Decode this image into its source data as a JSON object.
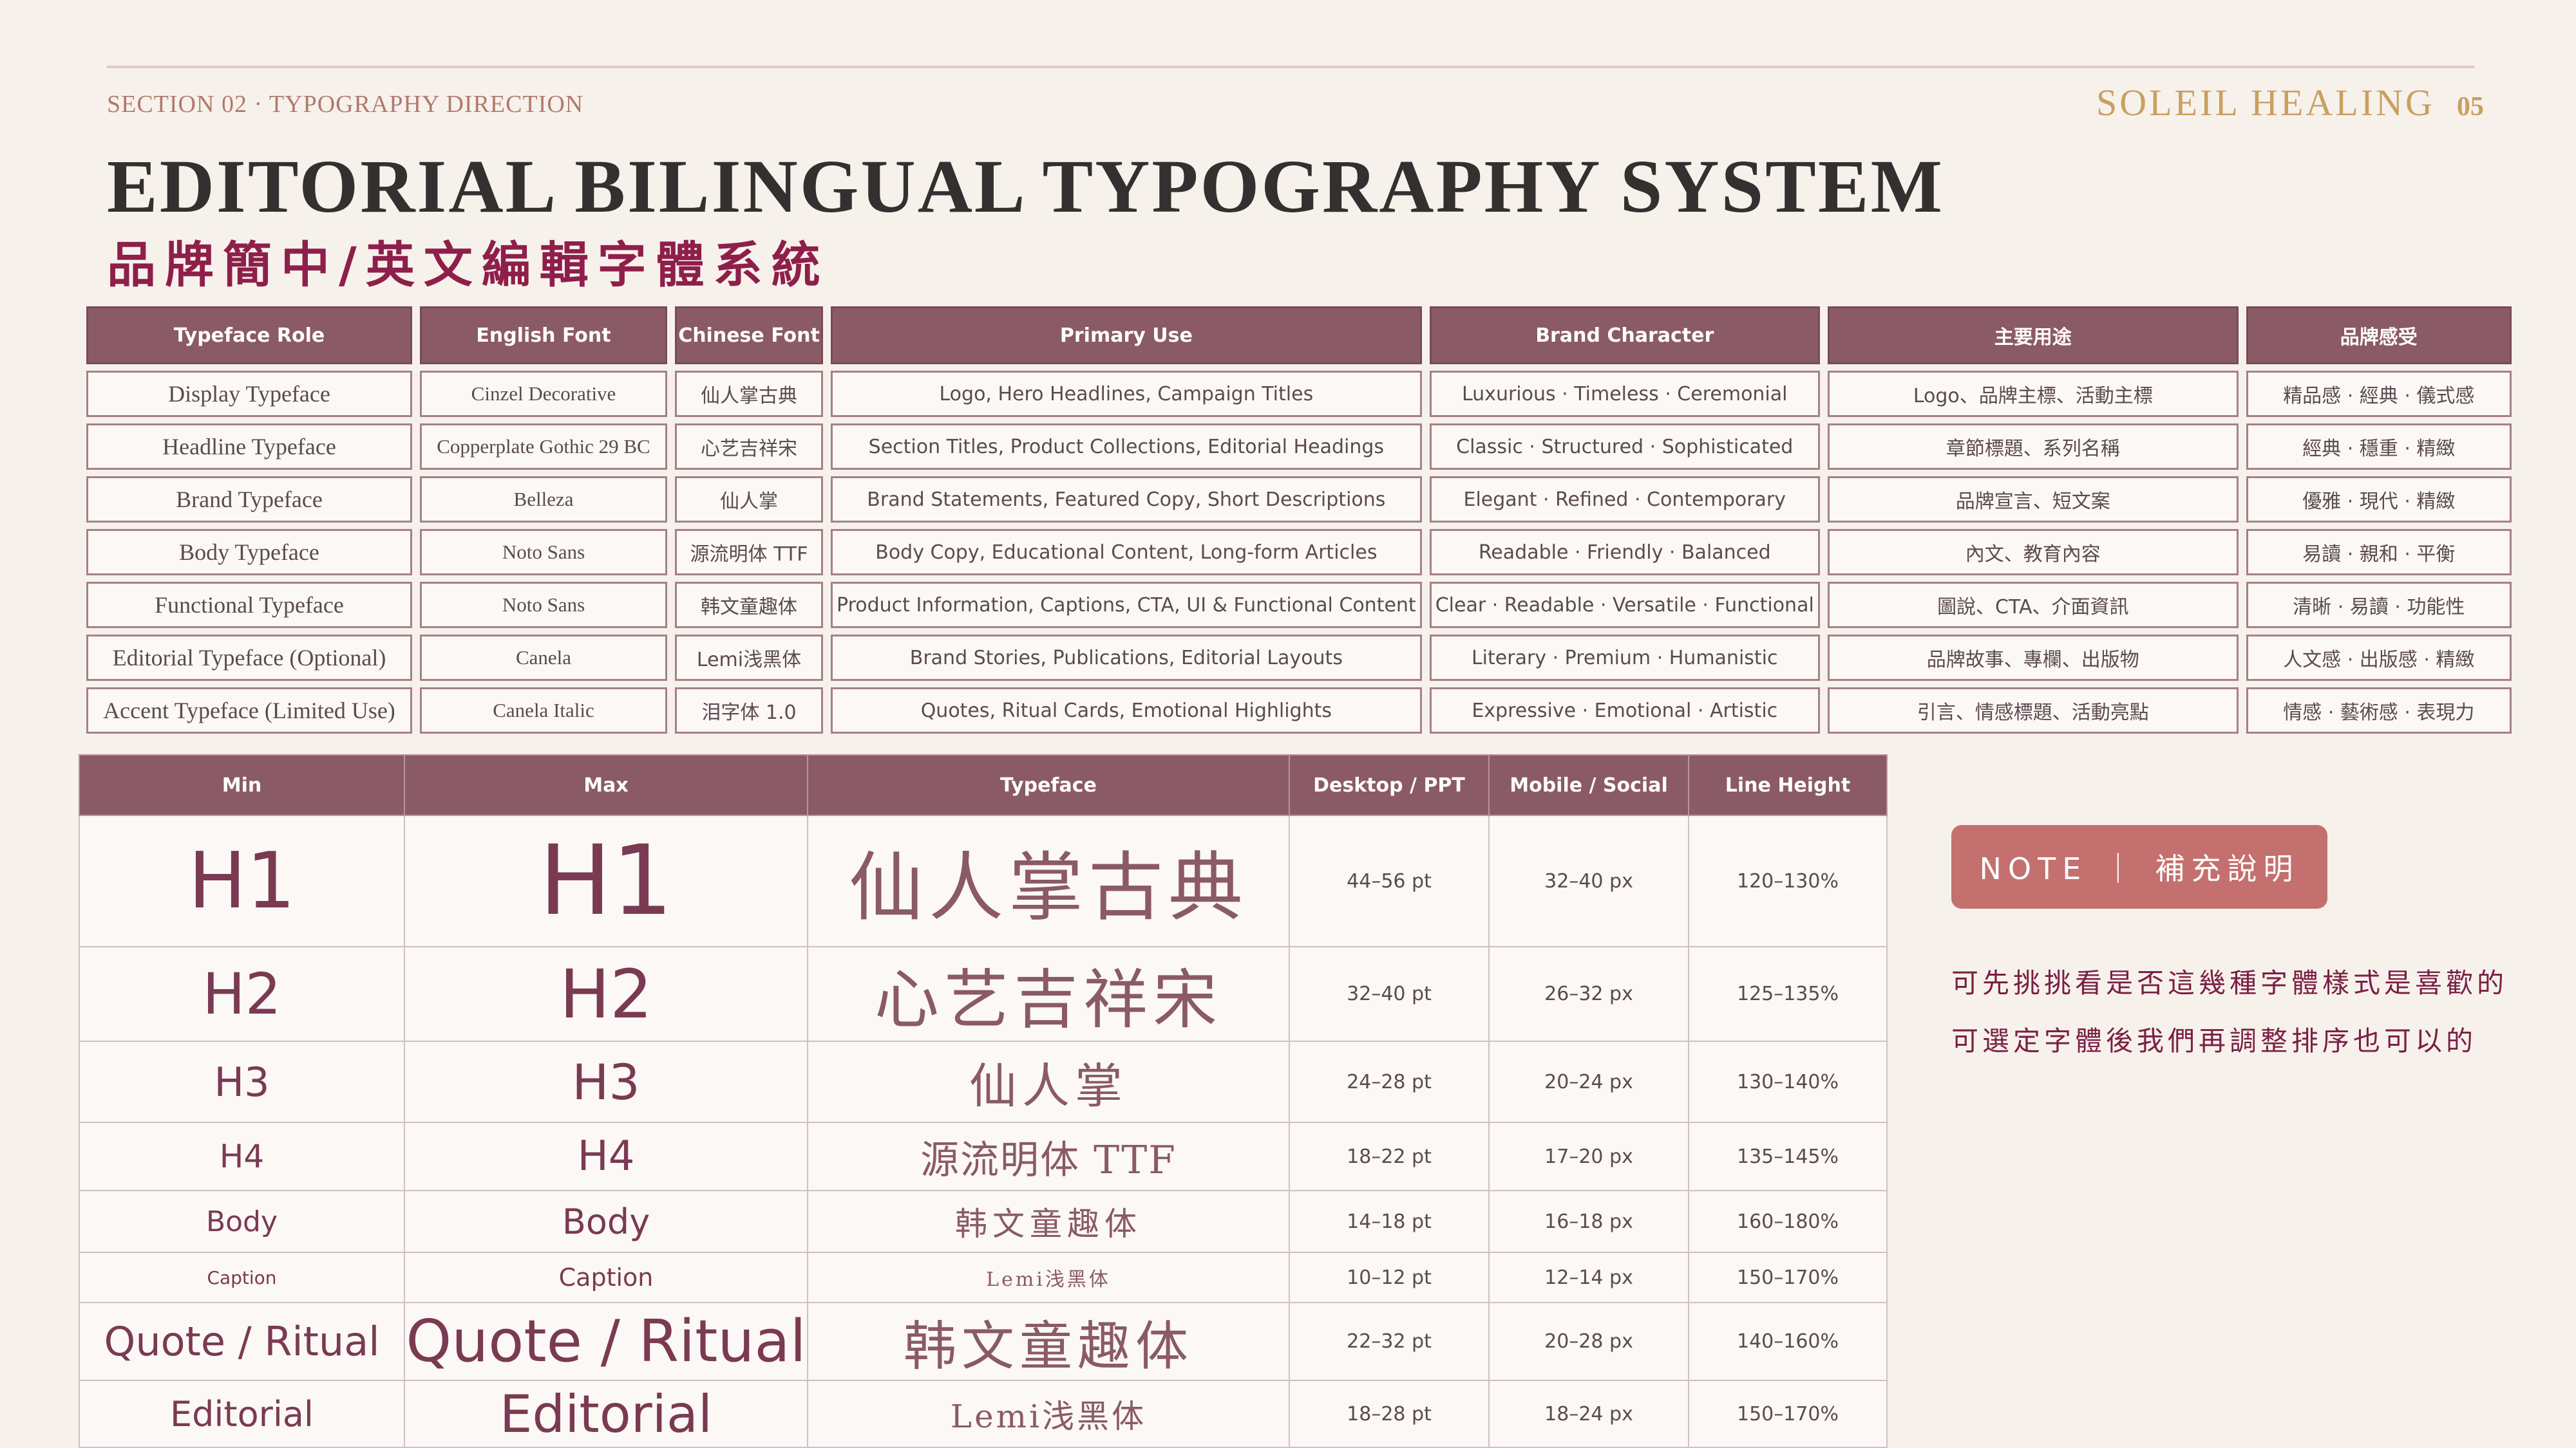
{
  "header": {
    "section_label": "SECTION 02 · TYPOGRAPHY DIRECTION",
    "brand_name": "SOLEIL HEALING",
    "page_number": "05",
    "title": "EDITORIAL BILINGUAL TYPOGRAPHY SYSTEM",
    "subtitle": "品牌簡中/英文編輯字體系統"
  },
  "roles_table": {
    "headers": [
      "Typeface Role",
      "English Font",
      "Chinese Font",
      "Primary Use",
      "Brand Character",
      "主要用途",
      "品牌感受"
    ],
    "rows": [
      [
        "Display Typeface",
        "Cinzel Decorative",
        "仙人掌古典",
        "Logo, Hero Headlines, Campaign Titles",
        "Luxurious · Timeless · Ceremonial",
        "Logo、品牌主標、活動主標",
        "精品感 · 經典 · 儀式感"
      ],
      [
        "Headline Typeface",
        "Copperplate Gothic 29 BC",
        "心艺吉祥宋",
        "Section Titles, Product Collections, Editorial Headings",
        "Classic · Structured · Sophisticated",
        "章節標題、系列名稱",
        "經典 · 穩重 · 精緻"
      ],
      [
        "Brand Typeface",
        "Belleza",
        "仙人掌",
        "Brand Statements, Featured Copy, Short Descriptions",
        "Elegant · Refined · Contemporary",
        "品牌宣言、短文案",
        "優雅 · 現代 · 精緻"
      ],
      [
        "Body Typeface",
        "Noto Sans",
        "源流明体 TTF",
        "Body Copy, Educational Content, Long-form Articles",
        "Readable · Friendly · Balanced",
        "內文、教育內容",
        "易讀 · 親和 · 平衡"
      ],
      [
        "Functional Typeface",
        "Noto Sans",
        "韩文童趣体",
        "Product Information, Captions, CTA, UI & Functional Content",
        "Clear · Readable · Versatile · Functional",
        "圖說、CTA、介面資訊",
        "清晰 · 易讀 · 功能性"
      ],
      [
        "Editorial Typeface (Optional)",
        "Canela",
        "Lemi浅黑体",
        "Brand Stories, Publications, Editorial Layouts",
        "Literary · Premium · Humanistic",
        "品牌故事、專欄、出版物",
        "人文感 · 出版感 · 精緻"
      ],
      [
        "Accent Typeface (Limited Use)",
        "Canela Italic",
        "泪字体 1.0",
        "Quotes, Ritual Cards, Emotional Highlights",
        "Expressive · Emotional · Artistic",
        "引言、情感標題、活動亮點",
        "情感 · 藝術感 · 表現力"
      ]
    ]
  },
  "scale_table": {
    "headers": [
      "Min",
      "Max",
      "Typeface",
      "Desktop / PPT",
      "Mobile / Social",
      "Line Height"
    ],
    "rows": [
      {
        "min": "H1",
        "max": "H1",
        "typeface": "仙人掌古典",
        "desktop": "44–56 pt",
        "mobile": "32–40 px",
        "line_height": "120–130%"
      },
      {
        "min": "H2",
        "max": "H2",
        "typeface": "心艺吉祥宋",
        "desktop": "32–40 pt",
        "mobile": "26–32 px",
        "line_height": "125–135%"
      },
      {
        "min": "H3",
        "max": "H3",
        "typeface": "仙人掌",
        "desktop": "24–28 pt",
        "mobile": "20–24 px",
        "line_height": "130–140%"
      },
      {
        "min": "H4",
        "max": "H4",
        "typeface": "源流明体 TTF",
        "desktop": "18–22 pt",
        "mobile": "17–20 px",
        "line_height": "135–145%"
      },
      {
        "min": "Body",
        "max": "Body",
        "typeface": "韩文童趣体",
        "desktop": "14–18 pt",
        "mobile": "16–18 px",
        "line_height": "160–180%"
      },
      {
        "min": "Caption",
        "max": "Caption",
        "typeface": "Lemi浅黑体",
        "desktop": "10–12 pt",
        "mobile": "12–14 px",
        "line_height": "150–170%"
      },
      {
        "min": "Quote / Ritual",
        "max": "Quote / Ritual",
        "typeface": "韩文童趣体",
        "desktop": "22–32 pt",
        "mobile": "20–28 px",
        "line_height": "140–160%"
      },
      {
        "min": "Editorial",
        "max": "Editorial",
        "typeface": "Lemi浅黑体",
        "desktop": "18–28 pt",
        "mobile": "18–24 px",
        "line_height": "150–170%"
      }
    ]
  },
  "note": {
    "label": "NOTE ｜ 補充說明",
    "lines": [
      "可先挑挑看是否這幾種字體樣式是喜歡的",
      "可選定字體後我們再調整排序也可以的"
    ]
  },
  "colors": {
    "background": "#f7f1ec",
    "header_fill": "#8a5a66",
    "accent_red": "#8e1f4a",
    "note_button": "#c4706f",
    "brand_gold": "#c8a060"
  }
}
